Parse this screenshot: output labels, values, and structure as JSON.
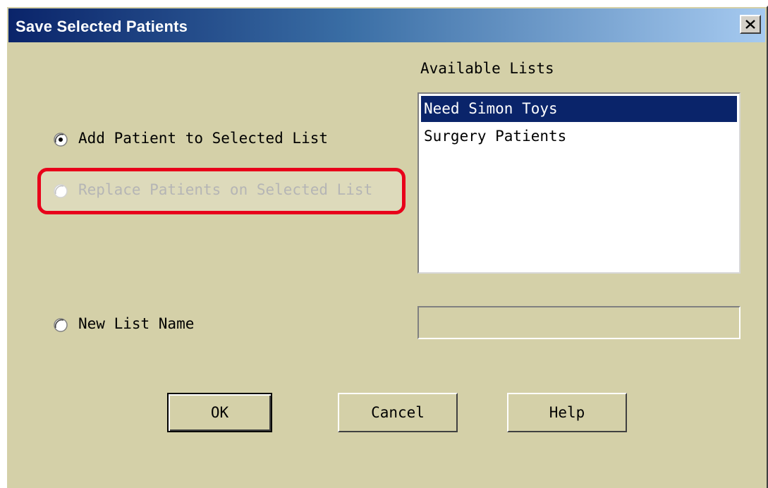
{
  "window": {
    "title": "Save Selected Patients"
  },
  "options": {
    "add_patient_label": "Add Patient to Selected List",
    "replace_patients_label": "Replace Patients on Selected List",
    "new_list_label": "New List Name",
    "selected": "add_patient"
  },
  "available_lists": {
    "label": "Available Lists",
    "items": [
      "Need Simon Toys",
      "Surgery Patients"
    ],
    "selected_index": 0
  },
  "new_list_name": {
    "value": ""
  },
  "buttons": {
    "ok": "OK",
    "cancel": "Cancel",
    "help": "Help"
  },
  "colors": {
    "dialog_background": "#d4d0a8",
    "title_gradient_start": "#0a246a",
    "title_gradient_end": "#a6caf0",
    "selection": "#0a246a",
    "highlight_annotation": "#e8001a"
  }
}
